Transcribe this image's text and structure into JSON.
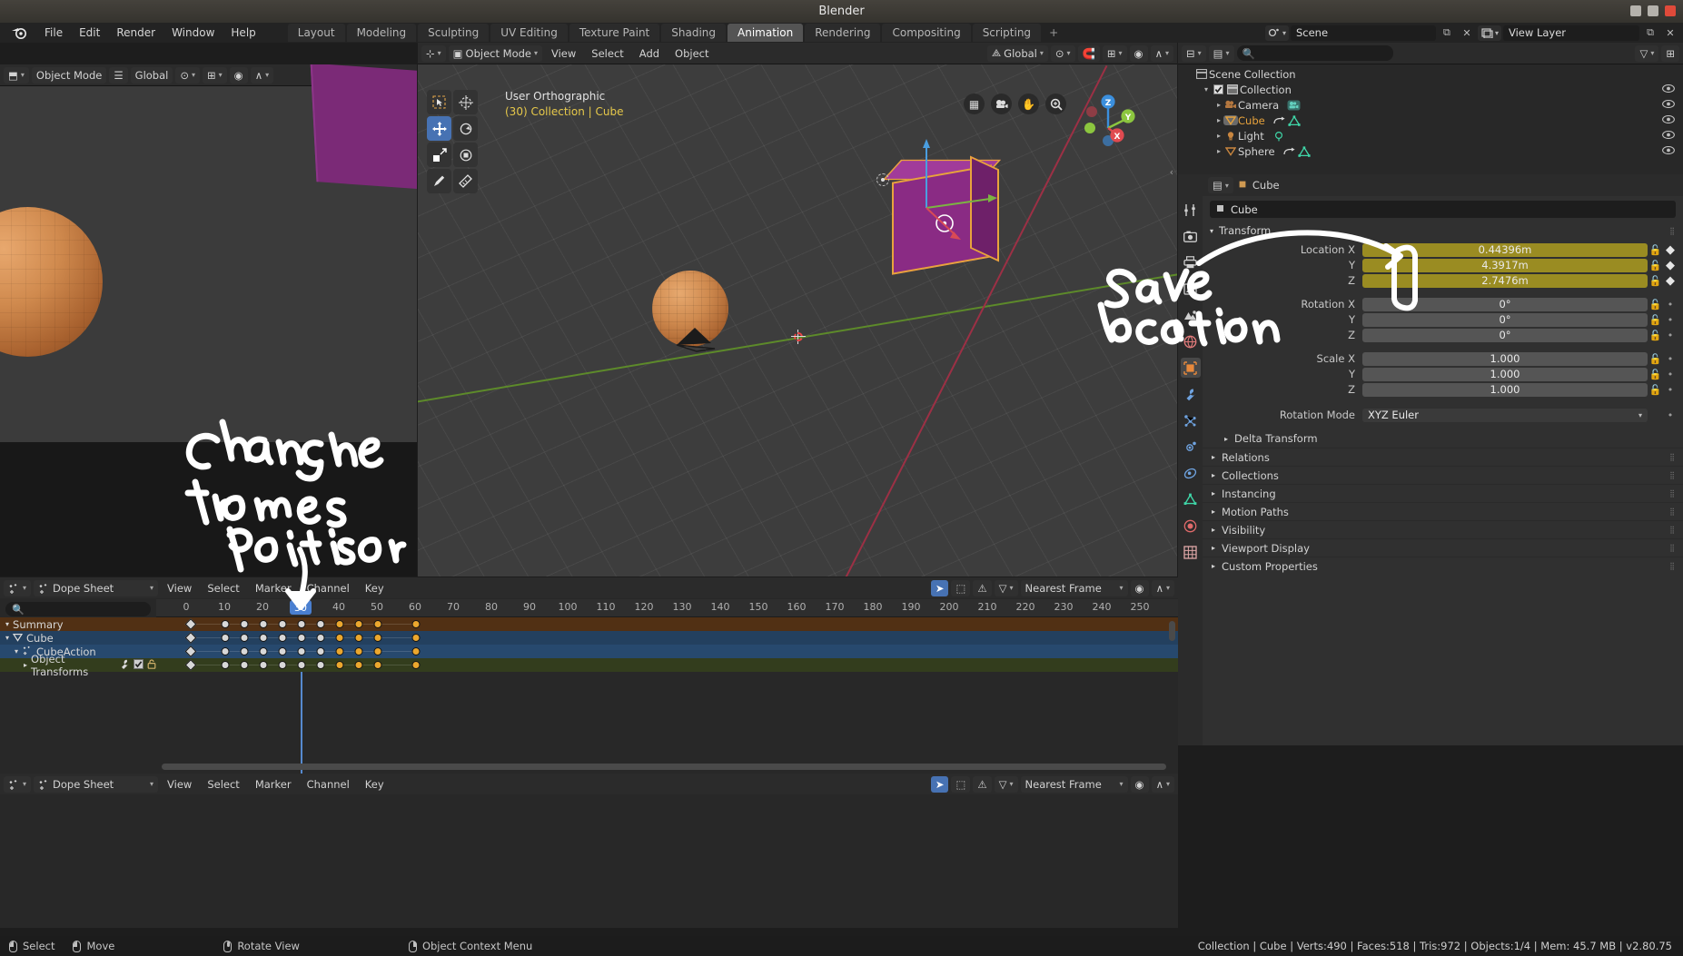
{
  "window": {
    "title": "Blender",
    "buttons": [
      "minimize",
      "maximize",
      "close"
    ]
  },
  "topbar": {
    "logo": "blender-logo",
    "menus": [
      "File",
      "Edit",
      "Render",
      "Window",
      "Help"
    ],
    "workspaces": [
      "Layout",
      "Modeling",
      "Sculpting",
      "UV Editing",
      "Texture Paint",
      "Shading",
      "Animation",
      "Rendering",
      "Compositing",
      "Scripting"
    ],
    "active_workspace": "Animation",
    "add_workspace": "+",
    "scene": {
      "icon": "scene-icon",
      "value": "Scene",
      "copy": "duplicate-icon",
      "close": "x-icon"
    },
    "view_layer": {
      "icon": "view-layer-icon",
      "value": "View Layer",
      "copy": "duplicate-icon",
      "close": "x-icon"
    }
  },
  "viewport": {
    "header": {
      "editor_icon": "editor-type-3dview-icon",
      "mode": "Object Mode",
      "menus": [
        "View",
        "Select",
        "Add",
        "Object"
      ],
      "orientation": "Global",
      "pivot_icon": "pivot-icon",
      "snap_icon": "snap-magnet-icon",
      "proportional_icon": "proportional-edit-icon"
    },
    "overlay_view": "User Orthographic",
    "overlay_object": "(30) Collection | Cube",
    "tools": [
      {
        "name": "tweak-tool",
        "glyph": "⬚",
        "active": false
      },
      {
        "name": "cursor-tool",
        "glyph": "⊕",
        "active": false
      },
      {
        "name": "move-tool",
        "glyph": "✥",
        "active": true
      },
      {
        "name": "rotate-tool",
        "glyph": "⟳",
        "active": false
      },
      {
        "name": "scale-tool",
        "glyph": "⤡",
        "active": false
      },
      {
        "name": "transform-tool",
        "glyph": "⬡",
        "active": false
      },
      {
        "name": "annotate-tool",
        "glyph": "✎",
        "active": false
      },
      {
        "name": "measure-tool",
        "glyph": "📐",
        "active": false
      }
    ],
    "nav_buttons": [
      {
        "name": "toggle-grid-button",
        "glyph": "▦"
      },
      {
        "name": "camera-view-button",
        "glyph": "🎥"
      },
      {
        "name": "pan-view-button",
        "glyph": "✋"
      },
      {
        "name": "zoom-view-button",
        "glyph": "🔍"
      }
    ],
    "gizmo_axes": [
      {
        "label": "Z",
        "color": "#3b8fdd"
      },
      {
        "label": "Y",
        "color": "#8cc63f"
      },
      {
        "label": "X",
        "color": "#e04a50"
      }
    ],
    "shading_modes": [
      "wireframe",
      "solid",
      "material",
      "rendered"
    ],
    "objects": [
      "Cube",
      "Sphere",
      "Light",
      "3D Cursor"
    ]
  },
  "outliner": {
    "display_mode_icon": "outliner-icon",
    "filter_icon": "filter-icon",
    "search_placeholder": "",
    "new_collection_icon": "new-collection-icon",
    "rows": [
      {
        "indent": 0,
        "tri": "",
        "check": false,
        "icon": "scene-collection-icon",
        "label": "Scene Collection",
        "selected": false,
        "eye": false,
        "extras": []
      },
      {
        "indent": 1,
        "tri": "▾",
        "check": true,
        "icon": "collection-icon",
        "label": "Collection",
        "selected": false,
        "eye": true,
        "extras": []
      },
      {
        "indent": 2,
        "tri": "▸",
        "check": false,
        "icon": "camera-icon",
        "label": "Camera",
        "selected": false,
        "eye": true,
        "extras": [
          "camera-data-icon"
        ]
      },
      {
        "indent": 2,
        "tri": "▸",
        "check": false,
        "icon": "mesh-icon",
        "label": "Cube",
        "selected": true,
        "eye": true,
        "extras": [
          "animation-icon",
          "mesh-data-icon"
        ]
      },
      {
        "indent": 2,
        "tri": "▸",
        "check": false,
        "icon": "light-icon",
        "label": "Light",
        "selected": false,
        "eye": true,
        "extras": [
          "light-data-icon"
        ]
      },
      {
        "indent": 2,
        "tri": "▸",
        "check": false,
        "icon": "mesh-icon",
        "label": "Sphere",
        "selected": false,
        "eye": true,
        "extras": [
          "animation-icon",
          "mesh-data-icon"
        ]
      }
    ]
  },
  "properties": {
    "rail_tabs": [
      {
        "name": "tool-tab",
        "glyph": "⚙",
        "active": false
      },
      {
        "name": "render-tab",
        "glyph": "📷",
        "active": false
      },
      {
        "name": "output-tab",
        "glyph": "🖨",
        "active": false
      },
      {
        "name": "view-layer-tab",
        "glyph": "🖼",
        "active": false
      },
      {
        "name": "scene-tab",
        "glyph": "◑",
        "active": false
      },
      {
        "name": "world-tab",
        "glyph": "🌐",
        "active": false
      },
      {
        "name": "object-tab",
        "glyph": "▣",
        "active": true
      },
      {
        "name": "modifier-tab",
        "glyph": "🔧",
        "active": false
      },
      {
        "name": "particles-tab",
        "glyph": "⁂",
        "active": false
      },
      {
        "name": "physics-tab",
        "glyph": "⚡",
        "active": false
      },
      {
        "name": "constraints-tab",
        "glyph": "⛓",
        "active": false
      },
      {
        "name": "object-data-tab",
        "glyph": "▽",
        "active": false
      },
      {
        "name": "material-tab",
        "glyph": "●",
        "active": false
      },
      {
        "name": "texture-tab",
        "glyph": "▦",
        "active": false
      }
    ],
    "breadcrumb_icon": "object-icon",
    "breadcrumb": "Cube",
    "name_field": {
      "icon": "object-icon",
      "value": "Cube"
    },
    "transform_panel": {
      "title": "Transform",
      "rows": [
        {
          "label": "Location X",
          "value": "0.44396m",
          "keyed": true,
          "lock": "unlocked",
          "anim": "keyframe"
        },
        {
          "label": "Y",
          "value": "4.3917m",
          "keyed": true,
          "lock": "unlocked",
          "anim": "keyframe"
        },
        {
          "label": "Z",
          "value": "2.7476m",
          "keyed": true,
          "lock": "unlocked",
          "anim": "keyframe"
        },
        {
          "label": "Rotation X",
          "value": "0°",
          "keyed": false,
          "lock": "unlocked",
          "anim": "none"
        },
        {
          "label": "Y",
          "value": "0°",
          "keyed": false,
          "lock": "unlocked",
          "anim": "none"
        },
        {
          "label": "Z",
          "value": "0°",
          "keyed": false,
          "lock": "unlocked",
          "anim": "none"
        },
        {
          "label": "Scale X",
          "value": "1.000",
          "keyed": false,
          "lock": "unlocked",
          "anim": "none"
        },
        {
          "label": "Y",
          "value": "1.000",
          "keyed": false,
          "lock": "unlocked",
          "anim": "none"
        },
        {
          "label": "Z",
          "value": "1.000",
          "keyed": false,
          "lock": "unlocked",
          "anim": "none"
        }
      ],
      "rotation_mode": {
        "label": "Rotation Mode",
        "value": "XYZ Euler"
      }
    },
    "panels": [
      {
        "label": "Delta Transform",
        "arrow": "▸",
        "indent": true
      },
      {
        "label": "Relations",
        "arrow": "▸",
        "indent": false
      },
      {
        "label": "Collections",
        "arrow": "▸",
        "indent": false
      },
      {
        "label": "Instancing",
        "arrow": "▸",
        "indent": false
      },
      {
        "label": "Motion Paths",
        "arrow": "▸",
        "indent": false
      },
      {
        "label": "Visibility",
        "arrow": "▸",
        "indent": false
      },
      {
        "label": "Viewport Display",
        "arrow": "▸",
        "indent": false
      },
      {
        "label": "Custom Properties",
        "arrow": "▸",
        "indent": false
      }
    ]
  },
  "dopesheet": {
    "editor_icon": "dopesheet-icon",
    "mode": "Dope Sheet",
    "menus": [
      "View",
      "Select",
      "Marker",
      "Channel",
      "Key"
    ],
    "search_placeholder": "",
    "right_buttons": [
      {
        "name": "proportional-edit-button",
        "glyph": "➤",
        "active": true
      },
      {
        "name": "only-selected-button",
        "glyph": "⬚",
        "active": false
      },
      {
        "name": "show-errors-button",
        "glyph": "⚠",
        "active": false
      }
    ],
    "filter_icon": "filter-icon",
    "snap_mode": "Nearest Frame",
    "proportional_icon": "proportional-edit-icon",
    "falloff_icon": "falloff-icon",
    "current_frame": 30,
    "ruler_ticks": [
      0,
      10,
      20,
      30,
      40,
      50,
      60,
      70,
      80,
      90,
      100,
      110,
      120,
      130,
      140,
      150,
      160,
      170,
      180,
      190,
      200,
      210,
      220,
      230,
      240,
      250
    ],
    "channels": [
      {
        "label": "Summary",
        "tri": "▾",
        "icon": "",
        "color": "#5a3a1c",
        "keys": [
          0,
          10,
          15,
          20,
          25,
          30,
          35,
          40,
          45,
          50,
          60
        ],
        "selected_from": 40,
        "extras": []
      },
      {
        "label": "Cube",
        "tri": "▾",
        "icon": "mesh-icon",
        "color": "#2c4668",
        "keys": [
          0,
          10,
          15,
          20,
          25,
          30,
          35,
          40,
          45,
          50,
          60
        ],
        "selected_from": 40,
        "extras": []
      },
      {
        "label": "CubeAction",
        "tri": "▾",
        "icon": "action-icon",
        "color": "#2f4d76",
        "keys": [
          0,
          10,
          15,
          20,
          25,
          30,
          35,
          40,
          45,
          50,
          60
        ],
        "selected_from": 40,
        "extras": []
      },
      {
        "label": "Object Transforms",
        "tri": "▸",
        "icon": "",
        "color": "#37421f",
        "keys": [
          0,
          10,
          15,
          20,
          25,
          30,
          35,
          40,
          45,
          50,
          60
        ],
        "selected_from": 40,
        "extras": [
          "wrench-icon",
          "checkbox-icon",
          "lock-icon"
        ]
      }
    ]
  },
  "dopesheet_bottom": {
    "editor_icon": "dopesheet-icon",
    "mode": "Dope Sheet",
    "menus": [
      "View",
      "Select",
      "Marker",
      "Channel",
      "Key"
    ],
    "snap_mode": "Nearest Frame"
  },
  "statusbar": {
    "hints": [
      {
        "mouse": "left",
        "label": "Select"
      },
      {
        "mouse": "left-drag",
        "label": "Move"
      },
      {
        "mouse": "middle",
        "label": "Rotate View"
      },
      {
        "mouse": "right",
        "label": "Object Context Menu"
      }
    ],
    "info": "Collection | Cube | Verts:490 | Faces:518 | Tris:972 | Objects:1/4 | Mem: 45.7 MB | v2.80.75"
  },
  "annotations": [
    {
      "name": "save-location-annotation",
      "text": "Save location"
    },
    {
      "name": "change-frames-annotation",
      "text": "Change frames + positions"
    }
  ],
  "colors": {
    "accent_blue": "#4772b3",
    "keyframe_orange": "#eba72e",
    "selected_outline": "#e8a33c",
    "keyed_field": "#9a8c22",
    "playhead": "#5b93e0"
  }
}
